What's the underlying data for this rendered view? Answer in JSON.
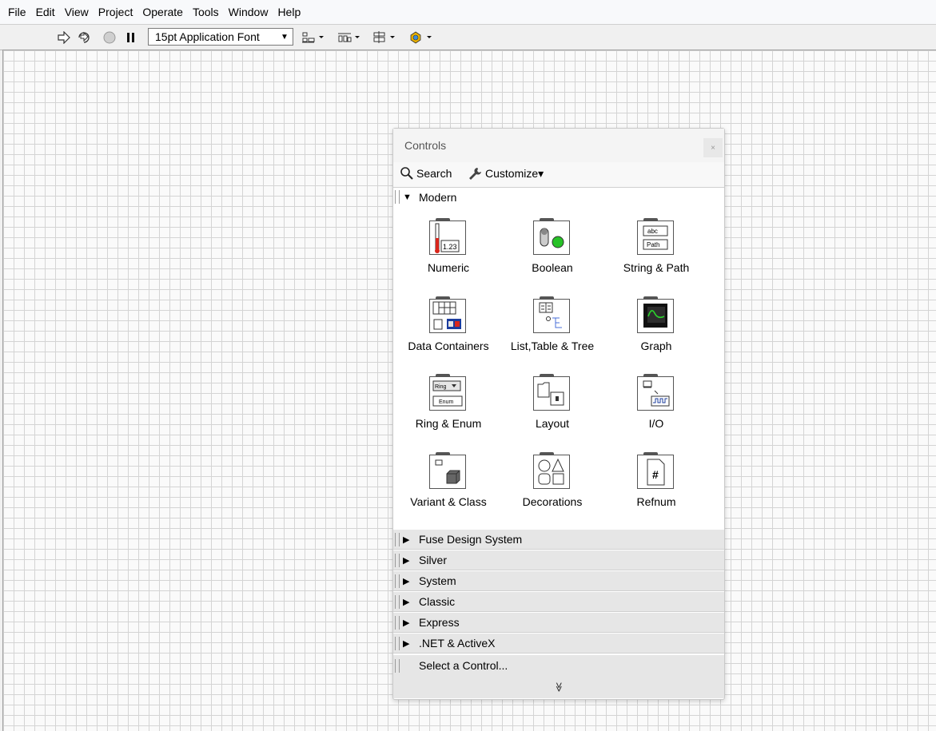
{
  "menubar": {
    "items": [
      "File",
      "Edit",
      "View",
      "Project",
      "Operate",
      "Tools",
      "Window",
      "Help"
    ]
  },
  "toolbar": {
    "font_select": "15pt Application Font"
  },
  "palette": {
    "title": "Controls",
    "close_label": "×",
    "search_label": "Search",
    "customize_label": "Customize▾",
    "modern_section": "Modern",
    "modern_items": [
      {
        "label": "Numeric",
        "icon": "numeric-icon"
      },
      {
        "label": "Boolean",
        "icon": "boolean-icon"
      },
      {
        "label": "String & Path",
        "icon": "string-path-icon"
      },
      {
        "label": "Data Containers",
        "icon": "data-containers-icon"
      },
      {
        "label": "List,Table & Tree",
        "icon": "list-table-tree-icon"
      },
      {
        "label": "Graph",
        "icon": "graph-icon"
      },
      {
        "label": "Ring & Enum",
        "icon": "ring-enum-icon"
      },
      {
        "label": "Layout",
        "icon": "layout-icon"
      },
      {
        "label": "I/O",
        "icon": "io-icon"
      },
      {
        "label": "Variant & Class",
        "icon": "variant-class-icon"
      },
      {
        "label": "Decorations",
        "icon": "decorations-icon"
      },
      {
        "label": "Refnum",
        "icon": "refnum-icon"
      }
    ],
    "collapsed_sections": [
      "Fuse Design System",
      "Silver",
      "System",
      "Classic",
      "Express",
      ".NET & ActiveX"
    ],
    "select_control": "Select a Control...",
    "more_glyph": "≫"
  },
  "icon_glyphs": {
    "numeric_readout": "1.23",
    "string_abc": "abc",
    "string_path": "Path",
    "ring_text": "Ring",
    "enum_text": "Enum",
    "refnum_hash": "#"
  }
}
